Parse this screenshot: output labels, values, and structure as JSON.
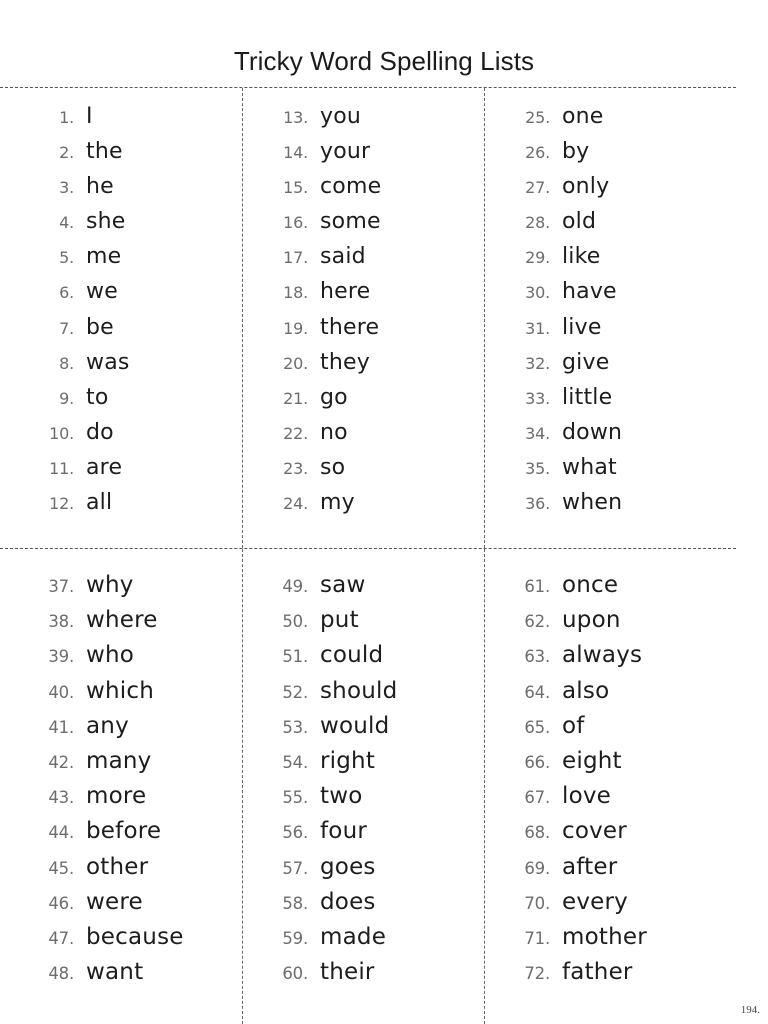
{
  "document": {
    "title": "Tricky Word Spelling Lists",
    "page_number": "194.",
    "colors": {
      "background": "#ffffff",
      "title_text": "#1b1b1b",
      "word_text": "#1d1d1d",
      "number_text": "#6d6d6d",
      "rule": "#555555"
    }
  },
  "blocks": [
    {
      "name": "top-block",
      "columns": [
        {
          "name": "column-1",
          "items": [
            {
              "num": "1.",
              "word": "I"
            },
            {
              "num": "2.",
              "word": "the"
            },
            {
              "num": "3.",
              "word": "he"
            },
            {
              "num": "4.",
              "word": "she"
            },
            {
              "num": "5.",
              "word": "me"
            },
            {
              "num": "6.",
              "word": "we"
            },
            {
              "num": "7.",
              "word": "be"
            },
            {
              "num": "8.",
              "word": "was"
            },
            {
              "num": "9.",
              "word": "to"
            },
            {
              "num": "10.",
              "word": "do"
            },
            {
              "num": "11.",
              "word": "are"
            },
            {
              "num": "12.",
              "word": "all"
            }
          ]
        },
        {
          "name": "column-2",
          "items": [
            {
              "num": "13.",
              "word": "you"
            },
            {
              "num": "14.",
              "word": "your"
            },
            {
              "num": "15.",
              "word": "come"
            },
            {
              "num": "16.",
              "word": "some"
            },
            {
              "num": "17.",
              "word": "said"
            },
            {
              "num": "18.",
              "word": "here"
            },
            {
              "num": "19.",
              "word": "there"
            },
            {
              "num": "20.",
              "word": "they"
            },
            {
              "num": "21.",
              "word": "go"
            },
            {
              "num": "22.",
              "word": "no"
            },
            {
              "num": "23.",
              "word": "so"
            },
            {
              "num": "24.",
              "word": "my"
            }
          ]
        },
        {
          "name": "column-3",
          "items": [
            {
              "num": "25.",
              "word": "one"
            },
            {
              "num": "26.",
              "word": "by"
            },
            {
              "num": "27.",
              "word": "only"
            },
            {
              "num": "28.",
              "word": "old"
            },
            {
              "num": "29.",
              "word": "like"
            },
            {
              "num": "30.",
              "word": "have"
            },
            {
              "num": "31.",
              "word": "live"
            },
            {
              "num": "32.",
              "word": "give"
            },
            {
              "num": "33.",
              "word": "little"
            },
            {
              "num": "34.",
              "word": "down"
            },
            {
              "num": "35.",
              "word": "what"
            },
            {
              "num": "36.",
              "word": "when"
            }
          ]
        }
      ]
    },
    {
      "name": "bottom-block",
      "columns": [
        {
          "name": "column-1",
          "items": [
            {
              "num": "37.",
              "word": "why"
            },
            {
              "num": "38.",
              "word": "where"
            },
            {
              "num": "39.",
              "word": "who"
            },
            {
              "num": "40.",
              "word": "which"
            },
            {
              "num": "41.",
              "word": "any"
            },
            {
              "num": "42.",
              "word": "many"
            },
            {
              "num": "43.",
              "word": "more"
            },
            {
              "num": "44.",
              "word": "before"
            },
            {
              "num": "45.",
              "word": "other"
            },
            {
              "num": "46.",
              "word": "were"
            },
            {
              "num": "47.",
              "word": "because"
            },
            {
              "num": "48.",
              "word": "want"
            }
          ]
        },
        {
          "name": "column-2",
          "items": [
            {
              "num": "49.",
              "word": "saw"
            },
            {
              "num": "50.",
              "word": "put"
            },
            {
              "num": "51.",
              "word": "could"
            },
            {
              "num": "52.",
              "word": "should"
            },
            {
              "num": "53.",
              "word": "would"
            },
            {
              "num": "54.",
              "word": "right"
            },
            {
              "num": "55.",
              "word": "two"
            },
            {
              "num": "56.",
              "word": "four"
            },
            {
              "num": "57.",
              "word": "goes"
            },
            {
              "num": "58.",
              "word": "does"
            },
            {
              "num": "59.",
              "word": "made"
            },
            {
              "num": "60.",
              "word": "their"
            }
          ]
        },
        {
          "name": "column-3",
          "items": [
            {
              "num": "61.",
              "word": "once"
            },
            {
              "num": "62.",
              "word": "upon"
            },
            {
              "num": "63.",
              "word": "always"
            },
            {
              "num": "64.",
              "word": "also"
            },
            {
              "num": "65.",
              "word": "of"
            },
            {
              "num": "66.",
              "word": "eight"
            },
            {
              "num": "67.",
              "word": "love"
            },
            {
              "num": "68.",
              "word": "cover"
            },
            {
              "num": "69.",
              "word": "after"
            },
            {
              "num": "70.",
              "word": "every"
            },
            {
              "num": "71.",
              "word": "mother"
            },
            {
              "num": "72.",
              "word": "father"
            }
          ]
        }
      ]
    }
  ]
}
